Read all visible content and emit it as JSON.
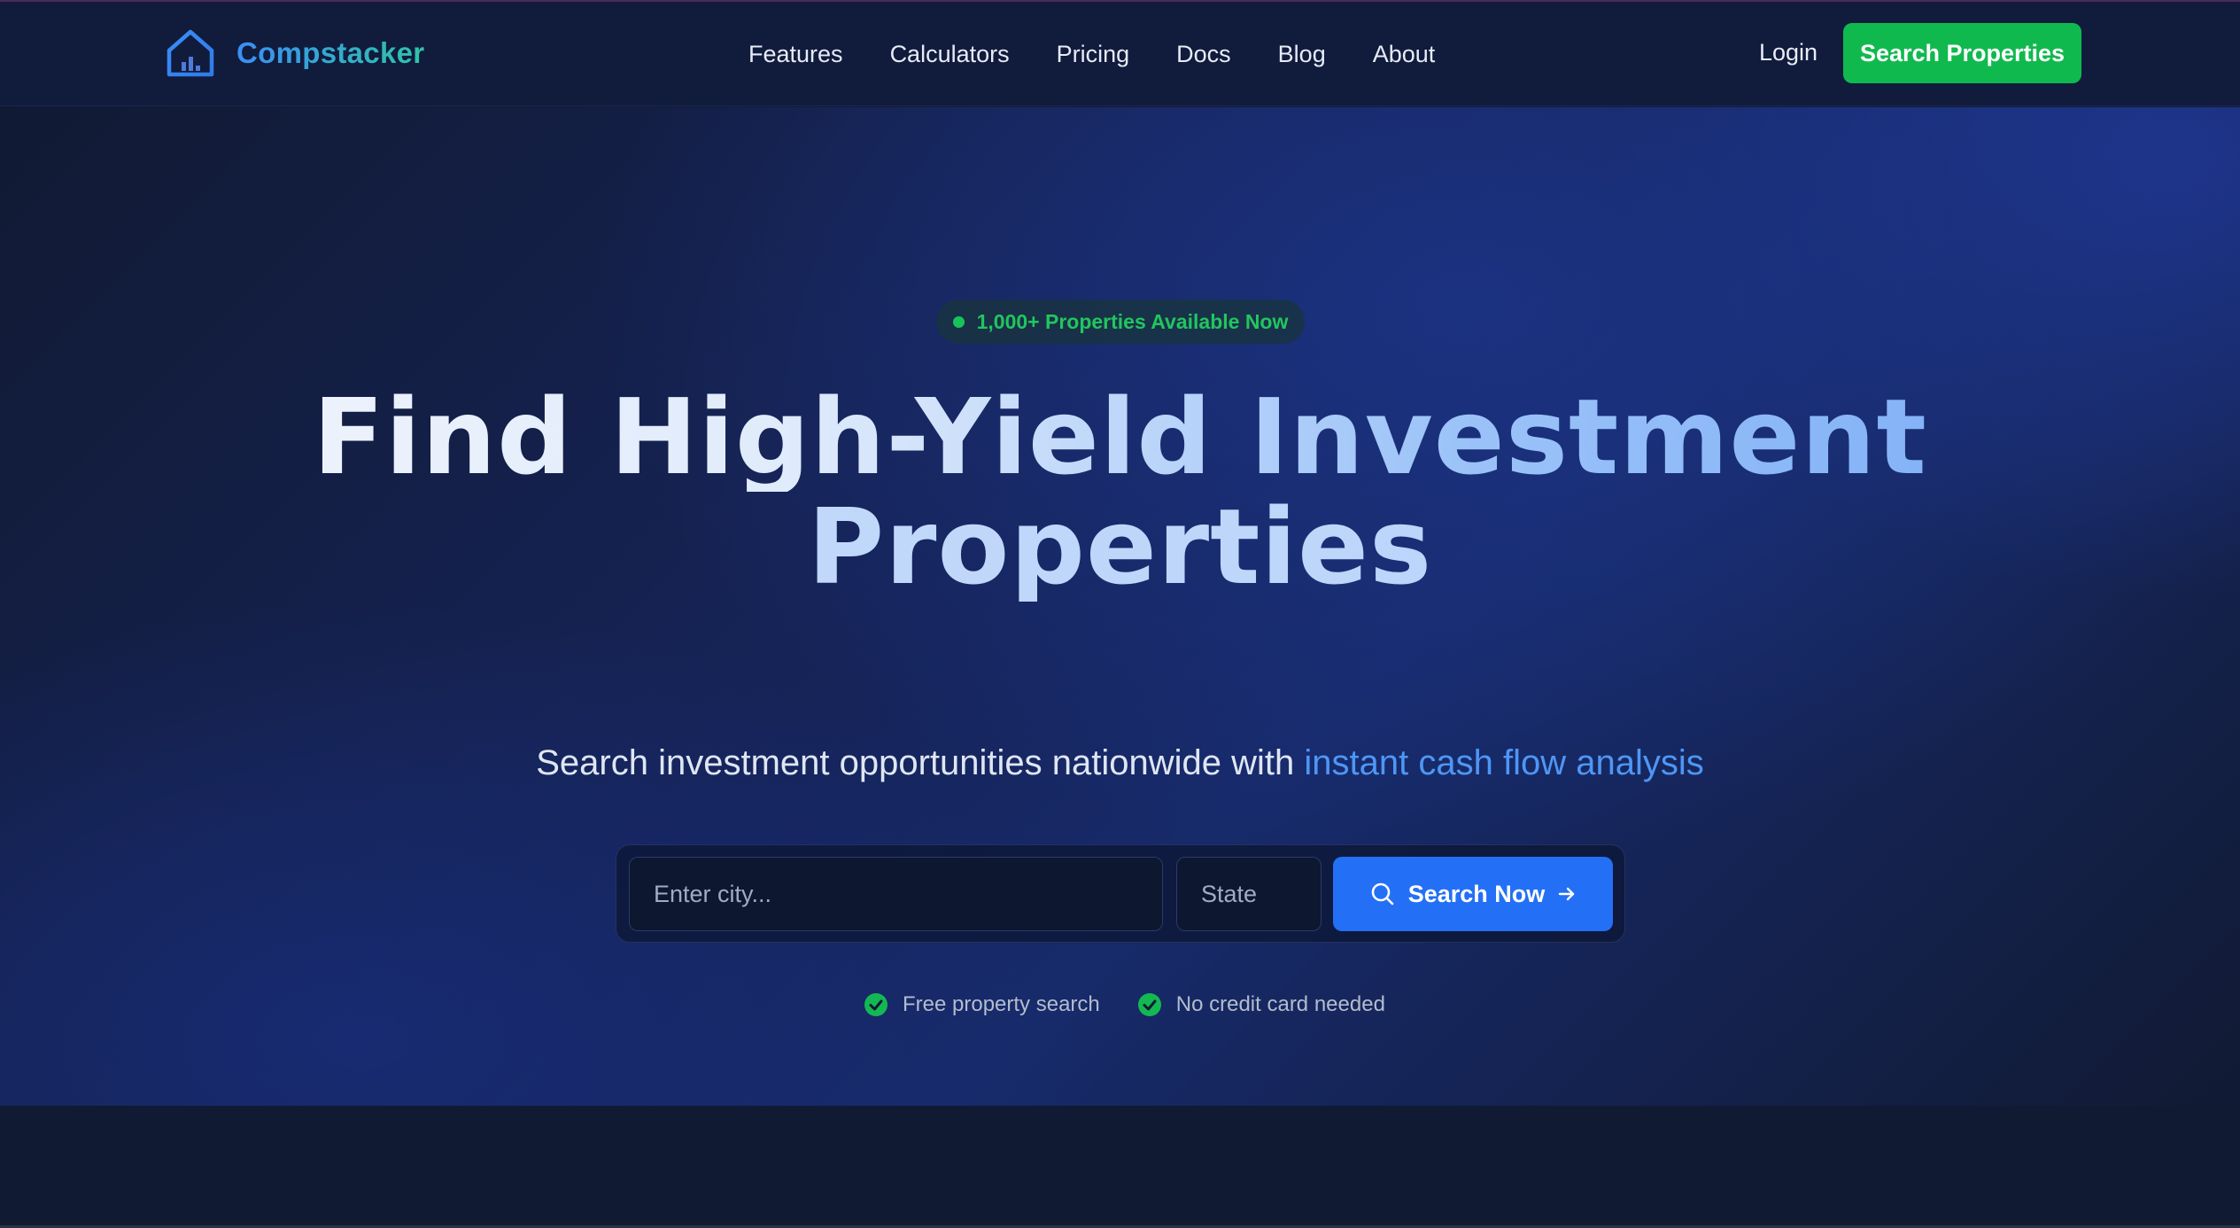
{
  "header": {
    "brand": "Compstacker",
    "nav": [
      "Features",
      "Calculators",
      "Pricing",
      "Docs",
      "Blog",
      "About"
    ],
    "login": "Login",
    "cta": "Search Properties"
  },
  "hero": {
    "badge": "1,000+ Properties Available Now",
    "headline_line1": "Find High-Yield Investment",
    "headline_line2": "Properties",
    "subtitle_prefix": "Search investment opportunities nationwide with ",
    "subtitle_highlight": "instant cash flow analysis",
    "search": {
      "city_placeholder": "Enter city...",
      "state_placeholder": "State",
      "button": "Search Now"
    },
    "perks": [
      "Free property search",
      "No credit card needed"
    ]
  },
  "icons": {
    "logo": "house-chart-icon",
    "search": "search-icon",
    "arrow": "arrow-right-icon",
    "check": "check-circle-icon"
  },
  "colors": {
    "accent_green": "#10b94e",
    "accent_blue": "#2370f6",
    "highlight_blue": "#4e96f5",
    "background": "#111a33"
  }
}
